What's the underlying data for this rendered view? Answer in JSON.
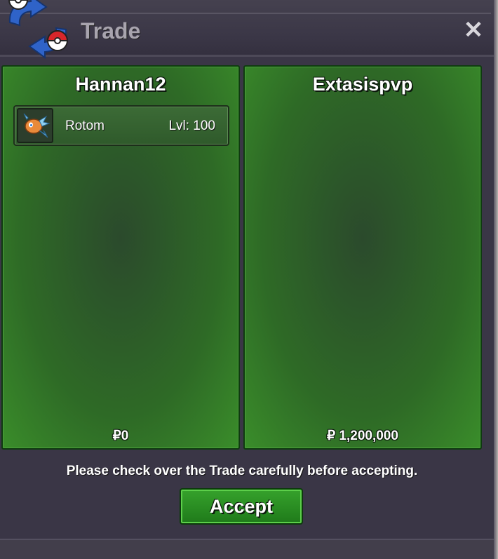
{
  "window": {
    "title": "Trade",
    "close_symbol": "✕",
    "icon": "trade-exchange-icon"
  },
  "left_panel": {
    "player_name": "Hannan12",
    "items": [
      {
        "name": "Rotom",
        "level": "Lvl: 100",
        "icon": "rotom-icon"
      }
    ],
    "money": "₽0"
  },
  "right_panel": {
    "player_name": "Extasispvp",
    "items": [],
    "money": "₽ 1,200,000"
  },
  "notice": "Please check over the Trade carefully before accepting.",
  "accept_label": "Accept",
  "colors": {
    "panel_green": "#2e6a26",
    "button_green": "#2a8f22",
    "window_bg": "#3a3646"
  }
}
